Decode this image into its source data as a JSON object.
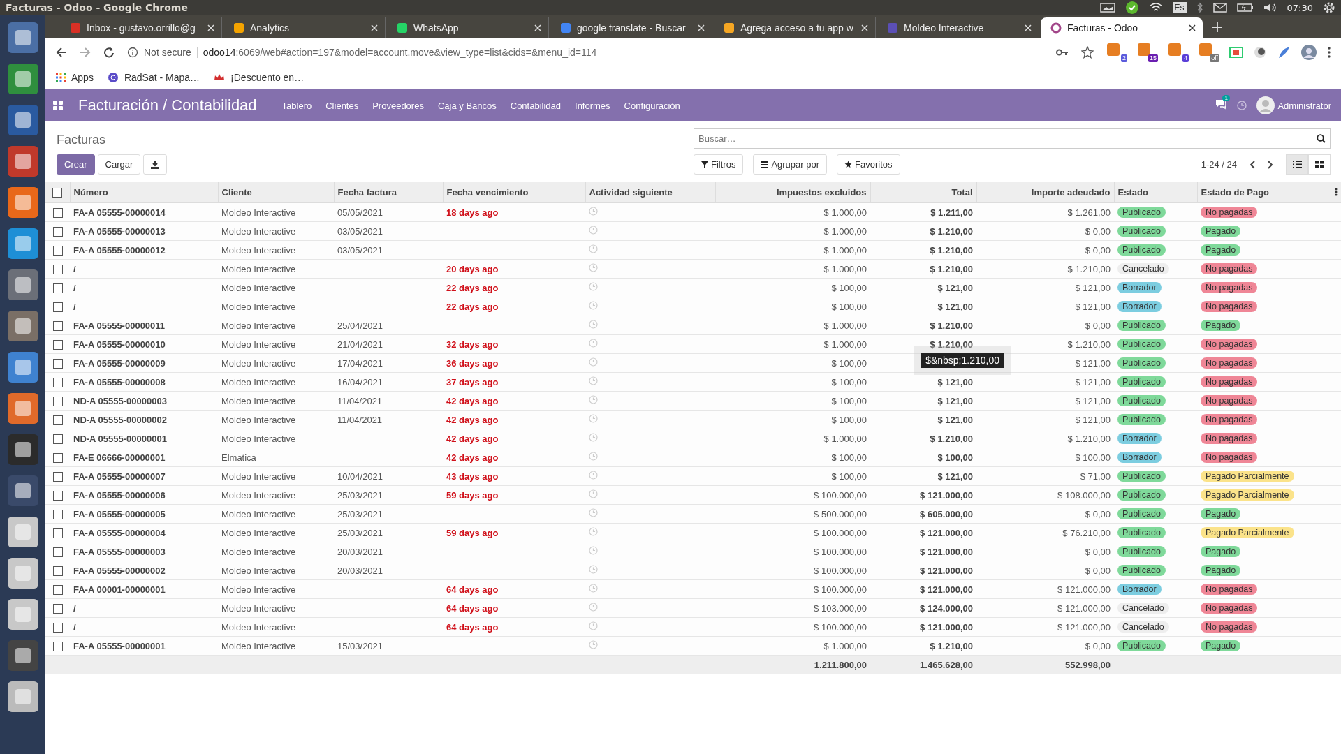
{
  "desktop": {
    "window_title": "Facturas - Odoo - Google Chrome",
    "keyboard": "Es",
    "clock": "07:30"
  },
  "browser": {
    "tabs": [
      {
        "title": "Inbox - gustavo.orrillo@g",
        "kind": "mail",
        "selected": false
      },
      {
        "title": "Analytics",
        "kind": "analytics",
        "selected": false
      },
      {
        "title": "WhatsApp",
        "kind": "chat",
        "selected": false
      },
      {
        "title": "google translate - Buscar",
        "kind": "search",
        "selected": false
      },
      {
        "title": "Agrega acceso a tu app w",
        "kind": "flame",
        "selected": false
      },
      {
        "title": "Moldeo Interactive",
        "kind": "site",
        "selected": false
      },
      {
        "title": "Facturas - Odoo",
        "kind": "odoo",
        "selected": true
      }
    ],
    "security": "Not secure",
    "host": "odoo14",
    "path": ":6069/web#action=197&model=account.move&view_type=list&cids=&menu_id=114",
    "extension_badges": [
      {
        "text": "2",
        "color": "#5b5bdc"
      },
      {
        "text": "15",
        "color": "#6a1fb0"
      },
      {
        "text": "4",
        "color": "#5b3fd8"
      },
      {
        "text": "off",
        "color": "#777777"
      }
    ],
    "bookmarks": [
      "Apps",
      "RadSat - Mapa…",
      "¡Descuento en…"
    ]
  },
  "app": {
    "title": "Facturación / Contabilidad",
    "menu": [
      "Tablero",
      "Clientes",
      "Proveedores",
      "Caja y Bancos",
      "Contabilidad",
      "Informes",
      "Configuración"
    ],
    "messages_badge": "1",
    "user": "Administrator"
  },
  "control_panel": {
    "breadcrumb": "Facturas",
    "buttons": [
      "Crear",
      "Cargar"
    ],
    "search": {
      "placeholder": "Buscar…"
    },
    "filters": [
      "Filtros",
      "Agrupar por",
      "Favoritos"
    ],
    "pager": "1-24 / 24",
    "views": [
      {
        "kind": "list",
        "selected": true
      },
      {
        "kind": "kanban",
        "selected": false
      }
    ]
  },
  "table": {
    "select_all": {
      "checked": false
    },
    "columns": [
      "Número",
      "Cliente",
      "Fecha factura",
      "Fecha vencimiento",
      "Actividad siguiente",
      "Impuestos excluidos",
      "Total",
      "Importe adeudado",
      "Estado",
      "Estado de Pago"
    ],
    "rows": [
      {
        "checked": false,
        "numero": "FA-A 05555-00000014",
        "cliente": "Moldeo Interactive",
        "fecha": "05/05/2021",
        "vencimiento": "18 days ago",
        "impuestos": "$ 1.000,00",
        "total": "$ 1.211,00",
        "adeudado": "$ 1.261,00",
        "estado": {
          "label": "Publicado",
          "color": "#7fd99a"
        },
        "pago": {
          "label": "No pagadas",
          "color": "#ef8696"
        }
      },
      {
        "checked": false,
        "numero": "FA-A 05555-00000013",
        "cliente": "Moldeo Interactive",
        "fecha": "03/05/2021",
        "impuestos": "$ 1.000,00",
        "total": "$ 1.210,00",
        "adeudado": "$ 0,00",
        "estado": {
          "label": "Publicado",
          "color": "#7fd99a"
        },
        "pago": {
          "label": "Pagado",
          "color": "#7fd99a"
        }
      },
      {
        "checked": false,
        "numero": "FA-A 05555-00000012",
        "cliente": "Moldeo Interactive",
        "fecha": "03/05/2021",
        "impuestos": "$ 1.000,00",
        "total": "$ 1.210,00",
        "adeudado": "$ 0,00",
        "estado": {
          "label": "Publicado",
          "color": "#7fd99a"
        },
        "pago": {
          "label": "Pagado",
          "color": "#7fd99a"
        }
      },
      {
        "checked": false,
        "numero": "/",
        "cliente": "Moldeo Interactive",
        "vencimiento": "20 days ago",
        "impuestos": "$ 1.000,00",
        "total": "$ 1.210,00",
        "adeudado": "$ 1.210,00",
        "estado": {
          "label": "Cancelado",
          "color": "#eeeeee"
        },
        "pago": {
          "label": "No pagadas",
          "color": "#ef8696"
        }
      },
      {
        "checked": false,
        "numero": "/",
        "cliente": "Moldeo Interactive",
        "vencimiento": "22 days ago",
        "impuestos": "$ 100,00",
        "total": "$ 121,00",
        "adeudado": "$ 121,00",
        "estado": {
          "label": "Borrador",
          "color": "#7ccde0"
        },
        "pago": {
          "label": "No pagadas",
          "color": "#ef8696"
        }
      },
      {
        "checked": false,
        "numero": "/",
        "cliente": "Moldeo Interactive",
        "vencimiento": "22 days ago",
        "impuestos": "$ 100,00",
        "total": "$ 121,00",
        "adeudado": "$ 121,00",
        "estado": {
          "label": "Borrador",
          "color": "#7ccde0"
        },
        "pago": {
          "label": "No pagadas",
          "color": "#ef8696"
        }
      },
      {
        "checked": false,
        "numero": "FA-A 05555-00000011",
        "cliente": "Moldeo Interactive",
        "fecha": "25/04/2021",
        "impuestos": "$ 1.000,00",
        "total": "$ 1.210,00",
        "adeudado": "$ 0,00",
        "estado": {
          "label": "Publicado",
          "color": "#7fd99a"
        },
        "pago": {
          "label": "Pagado",
          "color": "#7fd99a"
        }
      },
      {
        "checked": false,
        "numero": "FA-A 05555-00000010",
        "cliente": "Moldeo Interactive",
        "fecha": "21/04/2021",
        "vencimiento": "32 days ago",
        "impuestos": "$ 1.000,00",
        "total": "$ 1.210,00",
        "adeudado": "$ 1.210,00",
        "estado": {
          "label": "Publicado",
          "color": "#7fd99a"
        },
        "pago": {
          "label": "No pagadas",
          "color": "#ef8696"
        }
      },
      {
        "checked": false,
        "numero": "FA-A 05555-00000009",
        "cliente": "Moldeo Interactive",
        "fecha": "17/04/2021",
        "vencimiento": "36 days ago",
        "impuestos": "$ 100,00",
        "tooltip": "$&nbsp;1.210,00",
        "adeudado": "$ 121,00",
        "estado": {
          "label": "Publicado",
          "color": "#7fd99a"
        },
        "pago": {
          "label": "No pagadas",
          "color": "#ef8696"
        }
      },
      {
        "checked": false,
        "numero": "FA-A 05555-00000008",
        "cliente": "Moldeo Interactive",
        "fecha": "16/04/2021",
        "vencimiento": "37 days ago",
        "impuestos": "$ 100,00",
        "total": "$ 121,00",
        "adeudado": "$ 121,00",
        "estado": {
          "label": "Publicado",
          "color": "#7fd99a"
        },
        "pago": {
          "label": "No pagadas",
          "color": "#ef8696"
        }
      },
      {
        "checked": false,
        "numero": "ND-A 05555-00000003",
        "cliente": "Moldeo Interactive",
        "fecha": "11/04/2021",
        "vencimiento": "42 days ago",
        "impuestos": "$ 100,00",
        "total": "$ 121,00",
        "adeudado": "$ 121,00",
        "estado": {
          "label": "Publicado",
          "color": "#7fd99a"
        },
        "pago": {
          "label": "No pagadas",
          "color": "#ef8696"
        }
      },
      {
        "checked": false,
        "numero": "ND-A 05555-00000002",
        "cliente": "Moldeo Interactive",
        "fecha": "11/04/2021",
        "vencimiento": "42 days ago",
        "impuestos": "$ 100,00",
        "total": "$ 121,00",
        "adeudado": "$ 121,00",
        "estado": {
          "label": "Publicado",
          "color": "#7fd99a"
        },
        "pago": {
          "label": "No pagadas",
          "color": "#ef8696"
        }
      },
      {
        "checked": false,
        "numero": "ND-A 05555-00000001",
        "cliente": "Moldeo Interactive",
        "vencimiento": "42 days ago",
        "impuestos": "$ 1.000,00",
        "total": "$ 1.210,00",
        "adeudado": "$ 1.210,00",
        "estado": {
          "label": "Borrador",
          "color": "#7ccde0"
        },
        "pago": {
          "label": "No pagadas",
          "color": "#ef8696"
        }
      },
      {
        "checked": false,
        "numero": "FA-E 06666-00000001",
        "cliente": "Elmatica",
        "vencimiento": "42 days ago",
        "impuestos": "$ 100,00",
        "total": "$ 100,00",
        "adeudado": "$ 100,00",
        "estado": {
          "label": "Borrador",
          "color": "#7ccde0"
        },
        "pago": {
          "label": "No pagadas",
          "color": "#ef8696"
        }
      },
      {
        "checked": false,
        "numero": "FA-A 05555-00000007",
        "cliente": "Moldeo Interactive",
        "fecha": "10/04/2021",
        "vencimiento": "43 days ago",
        "impuestos": "$ 100,00",
        "total": "$ 121,00",
        "adeudado": "$ 71,00",
        "estado": {
          "label": "Publicado",
          "color": "#7fd99a"
        },
        "pago": {
          "label": "Pagado Parcialmente",
          "color": "#fbe38a"
        }
      },
      {
        "checked": false,
        "numero": "FA-A 05555-00000006",
        "cliente": "Moldeo Interactive",
        "fecha": "25/03/2021",
        "vencimiento": "59 days ago",
        "impuestos": "$ 100.000,00",
        "total": "$ 121.000,00",
        "adeudado": "$ 108.000,00",
        "estado": {
          "label": "Publicado",
          "color": "#7fd99a"
        },
        "pago": {
          "label": "Pagado Parcialmente",
          "color": "#fbe38a"
        }
      },
      {
        "checked": false,
        "numero": "FA-A 05555-00000005",
        "cliente": "Moldeo Interactive",
        "fecha": "25/03/2021",
        "impuestos": "$ 500.000,00",
        "total": "$ 605.000,00",
        "adeudado": "$ 0,00",
        "estado": {
          "label": "Publicado",
          "color": "#7fd99a"
        },
        "pago": {
          "label": "Pagado",
          "color": "#7fd99a"
        }
      },
      {
        "checked": false,
        "numero": "FA-A 05555-00000004",
        "cliente": "Moldeo Interactive",
        "fecha": "25/03/2021",
        "vencimiento": "59 days ago",
        "impuestos": "$ 100.000,00",
        "total": "$ 121.000,00",
        "adeudado": "$ 76.210,00",
        "estado": {
          "label": "Publicado",
          "color": "#7fd99a"
        },
        "pago": {
          "label": "Pagado Parcialmente",
          "color": "#fbe38a"
        }
      },
      {
        "checked": false,
        "numero": "FA-A 05555-00000003",
        "cliente": "Moldeo Interactive",
        "fecha": "20/03/2021",
        "impuestos": "$ 100.000,00",
        "total": "$ 121.000,00",
        "adeudado": "$ 0,00",
        "estado": {
          "label": "Publicado",
          "color": "#7fd99a"
        },
        "pago": {
          "label": "Pagado",
          "color": "#7fd99a"
        }
      },
      {
        "checked": false,
        "numero": "FA-A 05555-00000002",
        "cliente": "Moldeo Interactive",
        "fecha": "20/03/2021",
        "impuestos": "$ 100.000,00",
        "total": "$ 121.000,00",
        "adeudado": "$ 0,00",
        "estado": {
          "label": "Publicado",
          "color": "#7fd99a"
        },
        "pago": {
          "label": "Pagado",
          "color": "#7fd99a"
        }
      },
      {
        "checked": false,
        "numero": "FA-A 00001-00000001",
        "cliente": "Moldeo Interactive",
        "vencimiento": "64 days ago",
        "impuestos": "$ 100.000,00",
        "total": "$ 121.000,00",
        "adeudado": "$ 121.000,00",
        "estado": {
          "label": "Borrador",
          "color": "#7ccde0"
        },
        "pago": {
          "label": "No pagadas",
          "color": "#ef8696"
        }
      },
      {
        "checked": false,
        "numero": "/",
        "cliente": "Moldeo Interactive",
        "vencimiento": "64 days ago",
        "impuestos": "$ 103.000,00",
        "total": "$ 124.000,00",
        "adeudado": "$ 121.000,00",
        "estado": {
          "label": "Cancelado",
          "color": "#eeeeee"
        },
        "pago": {
          "label": "No pagadas",
          "color": "#ef8696"
        }
      },
      {
        "checked": false,
        "numero": "/",
        "cliente": "Moldeo Interactive",
        "vencimiento": "64 days ago",
        "impuestos": "$ 100.000,00",
        "total": "$ 121.000,00",
        "adeudado": "$ 121.000,00",
        "estado": {
          "label": "Cancelado",
          "color": "#eeeeee"
        },
        "pago": {
          "label": "No pagadas",
          "color": "#ef8696"
        }
      },
      {
        "checked": false,
        "numero": "FA-A 05555-00000001",
        "cliente": "Moldeo Interactive",
        "fecha": "15/03/2021",
        "impuestos": "$ 1.000,00",
        "total": "$ 1.210,00",
        "adeudado": "$ 0,00",
        "estado": {
          "label": "Publicado",
          "color": "#7fd99a"
        },
        "pago": {
          "label": "Pagado",
          "color": "#7fd99a"
        }
      }
    ],
    "totals": {
      "impuestos": "1.211.800,00",
      "total": "1.465.628,00",
      "adeudado": "552.998,00"
    }
  }
}
